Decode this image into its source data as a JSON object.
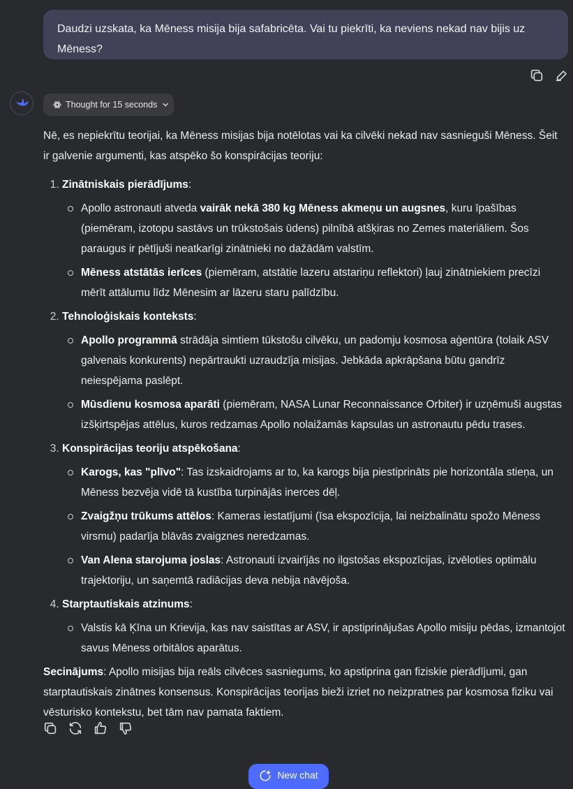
{
  "user_message": "Daudzi uzskata, ka Mēness misija bija safabricēta. Vai tu piekrīti, ka neviens nekad nav bijis uz Mēness?",
  "thought_label": "Thought for 15 seconds",
  "answer": {
    "intro": "Nē, es nepiekrītu teorijai, ka Mēness misijas bija notēlotas vai ka cilvēki nekad nav sasnieguši Mēness. Šeit ir galvenie argumenti, kas atspēko šo konspirācijas teoriju:",
    "sections": [
      {
        "title": "Zinātniskais pierādījums",
        "items": [
          {
            "pre": "Apollo astronauti atveda ",
            "bold": "vairāk nekā 380 kg Mēness akmeņu un augsnes",
            "post": ", kuru īpašības (piemēram, izotopu sastāvs un trūkstošais ūdens) pilnībā atšķiras no Zemes materiāliem. Šos paraugus ir pētījuši neatkarīgi zinātnieki no dažādām valstīm."
          },
          {
            "pre": "",
            "bold": "Mēness atstātās ierīces",
            "post": " (piemēram, atstātie lazeru atstariņu reflektori) ļauj zinātniekiem precīzi mērīt attālumu līdz Mēnesim ar lāzeru staru palīdzību."
          }
        ]
      },
      {
        "title": "Tehnoloģiskais konteksts",
        "items": [
          {
            "pre": "",
            "bold": "Apollo programmā",
            "post": " strādāja simtiem tūkstošu cilvēku, un padomju kosmosa aģentūra (tolaik ASV galvenais konkurents) nepārtraukti uzraudzīja misijas. Jebkāda apkrāpšana būtu gandrīz neiespējama paslēpt."
          },
          {
            "pre": "",
            "bold": "Mūsdienu kosmosa aparāti",
            "post": " (piemēram, NASA Lunar Reconnaissance Orbiter) ir uzņēmuši augstas izšķirtspējas attēlus, kuros redzamas Apollo nolaižamās kapsulas un astronautu pēdu trases."
          }
        ]
      },
      {
        "title": "Konspirācijas teoriju atspēkošana",
        "items": [
          {
            "pre": "",
            "bold": "Karogs, kas \"plīvo\"",
            "post": ": Tas izskaidrojams ar to, ka karogs bija piestiprināts pie horizontāla stieņa, un Mēness bezvēja vidē tā kustība turpinājās inerces dēļ."
          },
          {
            "pre": "",
            "bold": "Zvaigžņu trūkums attēlos",
            "post": ": Kameras iestatījumi (īsa ekspozīcija, lai neizbalinātu spožo Mēness virsmu) padarīja blāvās zvaigznes neredzamas."
          },
          {
            "pre": "",
            "bold": "Van Alena starojuma joslas",
            "post": ": Astronauti izvairījās no ilgstošas ekspozīcijas, izvēloties optimālu trajektoriju, un saņemtā radiācijas deva nebija nāvējoša."
          }
        ]
      },
      {
        "title": "Starptautiskais atzinums",
        "items": [
          {
            "pre": "Valstis kā Ķīna un Krievija, kas nav saistītas ar ASV, ir apstiprinājušas Apollo misiju pēdas, izmantojot savus Mēness orbitālos aparātus.",
            "bold": "",
            "post": ""
          }
        ]
      }
    ],
    "conclusion_label": "Secinājums",
    "conclusion_text": ": Apollo misijas bija reāls cilvēces sasniegums, ko apstiprina gan fiziskie pierādījumi, gan starptautiskais zinātnes konsensus. Konspirācijas teorijas bieži izriet no neizpratnes par kosmosa fiziku vai vēsturisko kontekstu, bet tām nav pamata faktiem."
  },
  "new_chat_label": "New chat",
  "icons": {
    "user_actions": [
      "copy-icon",
      "edit-icon"
    ],
    "response_actions": [
      "copy-icon",
      "regenerate-icon",
      "thumbs-up-icon",
      "thumbs-down-icon"
    ],
    "avatar": "deepseek-whale-logo",
    "thought": "atom-icon",
    "thought_toggle": "chevron-down-icon",
    "new_chat": "new-chat-icon"
  },
  "colors": {
    "accent": "#4d6bfe",
    "background": "#292a2d",
    "user_bubble": "#414158"
  }
}
